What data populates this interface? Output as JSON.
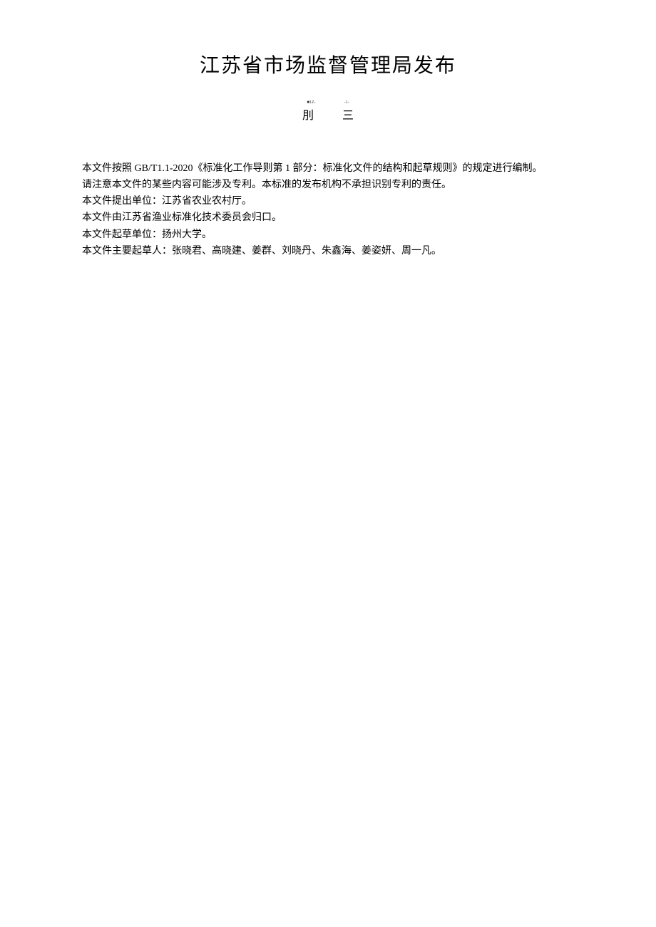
{
  "header": {
    "title": "江苏省市场监督管理局发布"
  },
  "subtitle": {
    "mark_left": "■1Z-",
    "mark_right": "-1-",
    "char_left": "刖",
    "char_right": "三"
  },
  "body": {
    "p1": "本文件按照 GB/T1.1-2020《标准化工作导则第 1 部分：标准化文件的结构和起草规则》的规定进行编制。",
    "p2": "请注意本文件的某些内容可能涉及专利。本标准的发布机构不承担识别专利的责任。",
    "p3": "本文件提出单位：江苏省农业农村厅。",
    "p4": "本文件由江苏省渔业标准化技术委员会归口。",
    "p5": "本文件起草单位：扬州大学。",
    "p6": "本文件主要起草人：张晓君、高晓建、姜群、刘晓丹、朱鑫海、姜姿妍、周一凡。"
  }
}
